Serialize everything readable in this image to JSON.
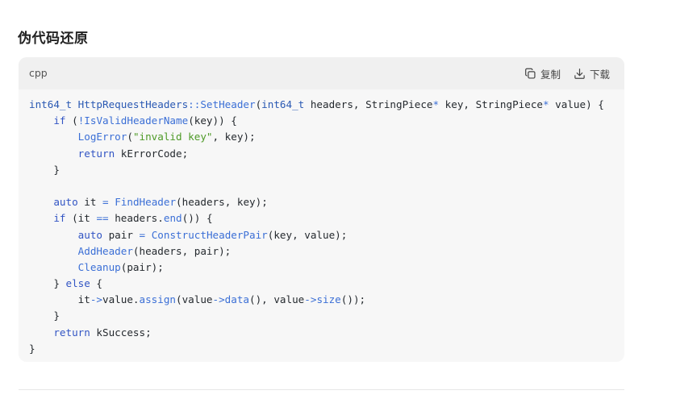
{
  "section": {
    "title": "伪代码还原"
  },
  "code_block": {
    "language": "cpp",
    "copy_label": "复制",
    "download_label": "下载",
    "lines": [
      [
        {
          "t": "int64_t ",
          "c": "type"
        },
        {
          "t": "HttpRequestHeaders",
          "c": "type"
        },
        {
          "t": "::",
          "c": "op"
        },
        {
          "t": "SetHeader",
          "c": "func"
        },
        {
          "t": "(",
          "c": "plain"
        },
        {
          "t": "int64_t",
          "c": "type"
        },
        {
          "t": " headers, ",
          "c": "plain"
        },
        {
          "t": "StringPiece",
          "c": "plain"
        },
        {
          "t": "*",
          "c": "op"
        },
        {
          "t": " key, ",
          "c": "plain"
        },
        {
          "t": "StringPiece",
          "c": "plain"
        },
        {
          "t": "*",
          "c": "op"
        },
        {
          "t": " value) {",
          "c": "plain"
        }
      ],
      [
        {
          "t": "    ",
          "c": "plain"
        },
        {
          "t": "if",
          "c": "kw"
        },
        {
          "t": " (",
          "c": "plain"
        },
        {
          "t": "!",
          "c": "op"
        },
        {
          "t": "IsValidHeaderName",
          "c": "func"
        },
        {
          "t": "(key)) {",
          "c": "plain"
        }
      ],
      [
        {
          "t": "        ",
          "c": "plain"
        },
        {
          "t": "LogError",
          "c": "func"
        },
        {
          "t": "(",
          "c": "plain"
        },
        {
          "t": "\"invalid key\"",
          "c": "str"
        },
        {
          "t": ", key);",
          "c": "plain"
        }
      ],
      [
        {
          "t": "        ",
          "c": "plain"
        },
        {
          "t": "return",
          "c": "kw"
        },
        {
          "t": " kErrorCode;",
          "c": "plain"
        }
      ],
      [
        {
          "t": "    }",
          "c": "plain"
        }
      ],
      [
        {
          "t": "",
          "c": "plain"
        }
      ],
      [
        {
          "t": "    ",
          "c": "plain"
        },
        {
          "t": "auto",
          "c": "kw"
        },
        {
          "t": " it ",
          "c": "plain"
        },
        {
          "t": "=",
          "c": "op"
        },
        {
          "t": " ",
          "c": "plain"
        },
        {
          "t": "FindHeader",
          "c": "func"
        },
        {
          "t": "(headers, key);",
          "c": "plain"
        }
      ],
      [
        {
          "t": "    ",
          "c": "plain"
        },
        {
          "t": "if",
          "c": "kw"
        },
        {
          "t": " (it ",
          "c": "plain"
        },
        {
          "t": "==",
          "c": "op"
        },
        {
          "t": " headers.",
          "c": "plain"
        },
        {
          "t": "end",
          "c": "func"
        },
        {
          "t": "()) {",
          "c": "plain"
        }
      ],
      [
        {
          "t": "        ",
          "c": "plain"
        },
        {
          "t": "auto",
          "c": "kw"
        },
        {
          "t": " pair ",
          "c": "plain"
        },
        {
          "t": "=",
          "c": "op"
        },
        {
          "t": " ",
          "c": "plain"
        },
        {
          "t": "ConstructHeaderPair",
          "c": "func"
        },
        {
          "t": "(key, value);",
          "c": "plain"
        }
      ],
      [
        {
          "t": "        ",
          "c": "plain"
        },
        {
          "t": "AddHeader",
          "c": "func"
        },
        {
          "t": "(headers, pair);",
          "c": "plain"
        }
      ],
      [
        {
          "t": "        ",
          "c": "plain"
        },
        {
          "t": "Cleanup",
          "c": "func"
        },
        {
          "t": "(pair);",
          "c": "plain"
        }
      ],
      [
        {
          "t": "    } ",
          "c": "plain"
        },
        {
          "t": "else",
          "c": "kw"
        },
        {
          "t": " {",
          "c": "plain"
        }
      ],
      [
        {
          "t": "        it",
          "c": "plain"
        },
        {
          "t": "->",
          "c": "op"
        },
        {
          "t": "value.",
          "c": "plain"
        },
        {
          "t": "assign",
          "c": "func"
        },
        {
          "t": "(value",
          "c": "plain"
        },
        {
          "t": "->",
          "c": "op"
        },
        {
          "t": "data",
          "c": "func"
        },
        {
          "t": "(), value",
          "c": "plain"
        },
        {
          "t": "->",
          "c": "op"
        },
        {
          "t": "size",
          "c": "func"
        },
        {
          "t": "());",
          "c": "plain"
        }
      ],
      [
        {
          "t": "    }",
          "c": "plain"
        }
      ],
      [
        {
          "t": "    ",
          "c": "plain"
        },
        {
          "t": "return",
          "c": "kw"
        },
        {
          "t": " kSuccess;",
          "c": "plain"
        }
      ],
      [
        {
          "t": "}",
          "c": "plain"
        }
      ]
    ]
  },
  "icons": {
    "copy": "copy-icon",
    "download": "download-icon"
  }
}
